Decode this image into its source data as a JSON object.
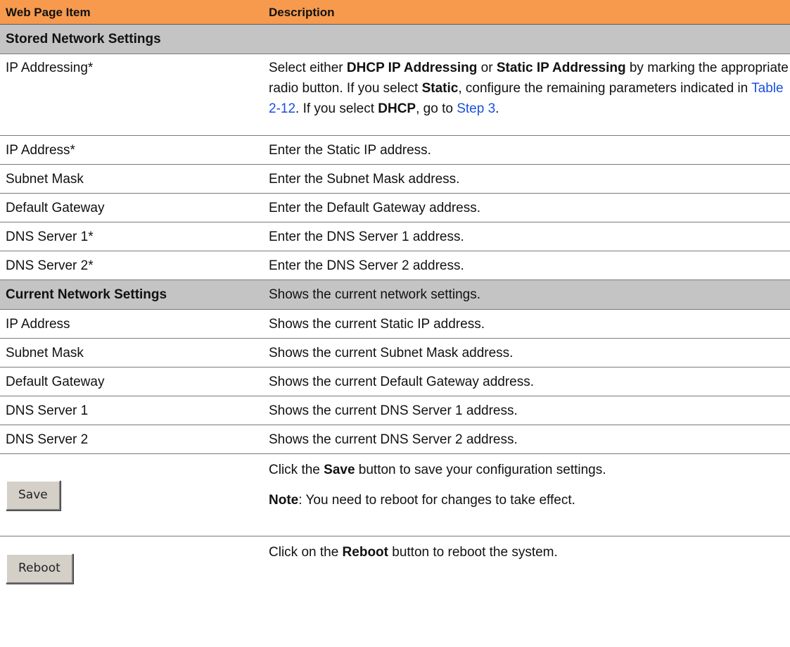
{
  "header": {
    "item": "Web Page Item",
    "description": "Description"
  },
  "stored": {
    "title": "Stored Network Settings",
    "ip_addressing": {
      "item": "IP Addressing*",
      "t1": "Select either ",
      "b1": "DHCP IP Addressing",
      "t2": " or ",
      "b2": "Static IP Addressing",
      "t3": " by marking the appropriate radio button. If you select ",
      "b3": "Static",
      "t4": ", configure the remaining parameters indicated in ",
      "link1": "Table 2-12",
      "t5": ". If you select ",
      "b4": "DHCP",
      "t6": ", go to ",
      "link2": "Step 3",
      "t7": "."
    },
    "rows": [
      {
        "item": "IP Address*",
        "desc": "Enter the Static IP address."
      },
      {
        "item": "Subnet Mask",
        "desc": "Enter the Subnet Mask address."
      },
      {
        "item": "Default Gateway",
        "desc": "Enter the Default Gateway address."
      },
      {
        "item": "DNS Server 1*",
        "desc": "Enter the DNS Server 1 address."
      },
      {
        "item": "DNS Server 2*",
        "desc": "Enter the DNS Server 2 address."
      }
    ]
  },
  "current": {
    "title": "Current Network Settings",
    "desc": "Shows the current network settings.",
    "rows": [
      {
        "item": "IP Address",
        "desc": "Shows the current Static IP address."
      },
      {
        "item": "Subnet Mask",
        "desc": "Shows the current Subnet Mask address."
      },
      {
        "item": "Default Gateway",
        "desc": "Shows the current Default Gateway address."
      },
      {
        "item": "DNS Server 1",
        "desc": "Shows the current DNS Server 1 address."
      },
      {
        "item": "DNS Server 2",
        "desc": "Shows the current DNS Server 2 address."
      }
    ]
  },
  "save": {
    "button_label": "Save",
    "d1": "Click the ",
    "d1b": "Save",
    "d1e": " button to save your configuration settings.",
    "note_label": "Note",
    "note_text": ": You need to reboot for changes to take effect."
  },
  "reboot": {
    "button_label": "Reboot",
    "d1": "Click on the ",
    "d1b": "Reboot",
    "d1e": " button to reboot the system."
  },
  "colors": {
    "header_bg": "#f79a4e",
    "section_bg": "#c4c4c4",
    "link": "#1a4fe0"
  }
}
